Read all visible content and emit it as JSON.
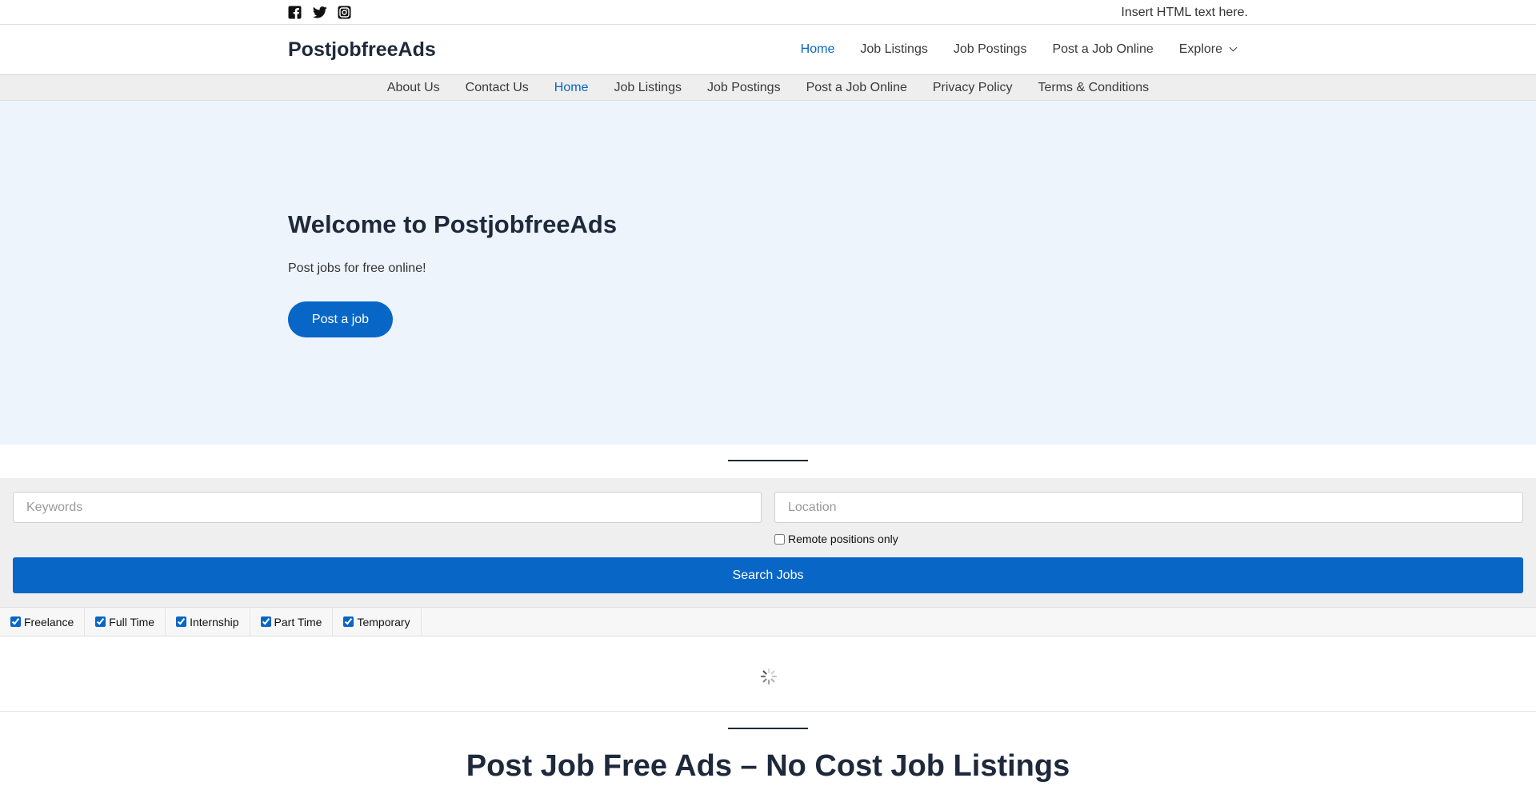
{
  "topbar": {
    "social_icons": [
      "facebook-icon",
      "twitter-icon",
      "instagram-icon"
    ],
    "text": "Insert HTML text here."
  },
  "header": {
    "brand": "PostjobfreeAds",
    "nav": [
      "Home",
      "Job Listings",
      "Job Postings",
      "Post a Job Online",
      "Explore"
    ],
    "active": "Home"
  },
  "subnav": {
    "items": [
      "About Us",
      "Contact Us",
      "Home",
      "Job Listings",
      "Job Postings",
      "Post a Job Online",
      "Privacy Policy",
      "Terms & Conditions"
    ],
    "active": "Home"
  },
  "hero": {
    "title": "Welcome to PostjobfreeAds",
    "subtitle": "Post jobs for free online!",
    "button": "Post a job"
  },
  "search": {
    "keywords_placeholder": "Keywords",
    "location_placeholder": "Location",
    "remote_label": "Remote positions only",
    "remote_checked": false,
    "button": "Search Jobs"
  },
  "job_types": [
    {
      "label": "Freelance",
      "checked": true
    },
    {
      "label": "Full Time",
      "checked": true
    },
    {
      "label": "Internship",
      "checked": true
    },
    {
      "label": "Part Time",
      "checked": true
    },
    {
      "label": "Temporary",
      "checked": true
    }
  ],
  "section": {
    "title": "Post Job Free Ads – No Cost Job Listings"
  },
  "colors": {
    "accent": "#0866c6",
    "hero_bg": "#edf4fc",
    "text": "#1e293b"
  }
}
